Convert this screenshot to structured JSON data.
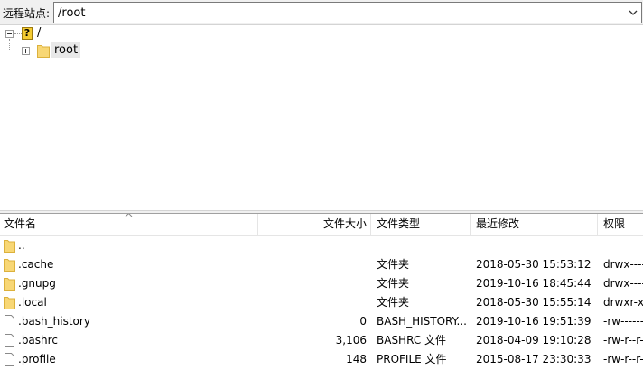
{
  "path_bar": {
    "label": "远程站点:",
    "value": "/root"
  },
  "tree": {
    "root": {
      "label": "/",
      "icon": "question-folder-icon"
    },
    "child": {
      "label": "root",
      "icon": "folder-icon"
    }
  },
  "list": {
    "columns": {
      "name": "文件名",
      "size": "文件大小",
      "type": "文件类型",
      "modified": "最近修改",
      "perms": "权限"
    },
    "rows": [
      {
        "name": "..",
        "size": "",
        "type": "",
        "modified": "",
        "perms": "",
        "icon": "folder-icon"
      },
      {
        "name": ".cache",
        "size": "",
        "type": "文件夹",
        "modified": "2018-05-30 15:53:12",
        "perms": "drwx------",
        "icon": "folder-icon"
      },
      {
        "name": ".gnupg",
        "size": "",
        "type": "文件夹",
        "modified": "2019-10-16 18:45:44",
        "perms": "drwx------",
        "icon": "folder-icon"
      },
      {
        "name": ".local",
        "size": "",
        "type": "文件夹",
        "modified": "2018-05-30 15:55:14",
        "perms": "drwxr-xr-x",
        "icon": "folder-icon"
      },
      {
        "name": ".bash_history",
        "size": "0",
        "type": "BASH_HISTORY...",
        "modified": "2019-10-16 19:51:39",
        "perms": "-rw-------",
        "icon": "file-icon"
      },
      {
        "name": ".bashrc",
        "size": "3,106",
        "type": "BASHRC 文件",
        "modified": "2018-04-09 19:10:28",
        "perms": "-rw-r--r--",
        "icon": "file-icon"
      },
      {
        "name": ".profile",
        "size": "148",
        "type": "PROFILE 文件",
        "modified": "2015-08-17 23:30:33",
        "perms": "-rw-r--r--",
        "icon": "file-icon"
      }
    ]
  },
  "colors": {
    "folder": "#f8d775",
    "folder_edge": "#dcb13c",
    "selection": "#e8e8e8"
  }
}
